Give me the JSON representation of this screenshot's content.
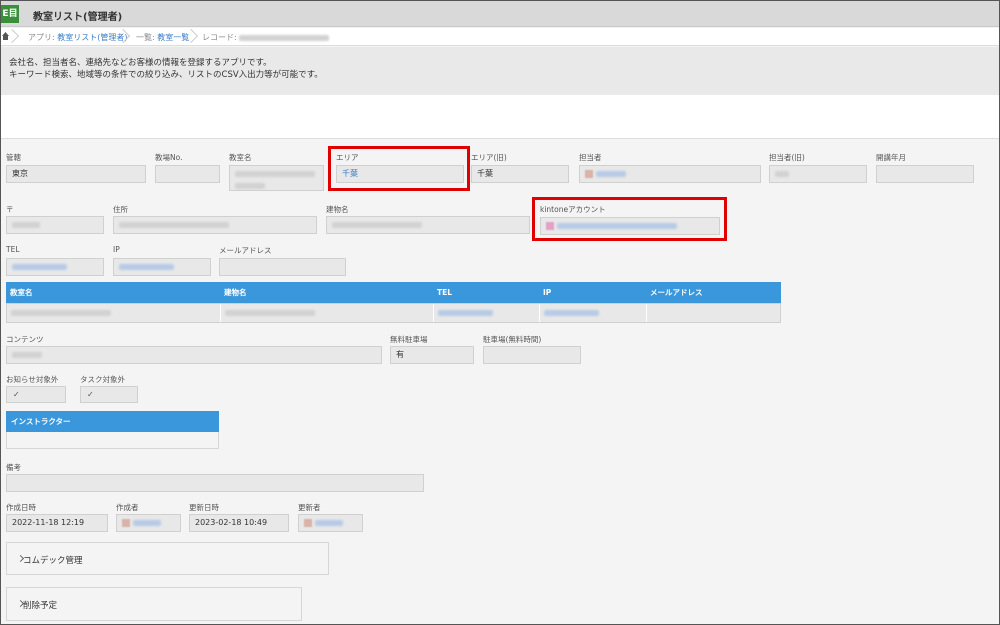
{
  "app": {
    "icon_text": "E目",
    "title": "教室リスト(管理者)"
  },
  "breadcrumb": {
    "app_prefix": "アプリ: ",
    "app_link": "教室リスト(管理者)",
    "list_prefix": "一覧: ",
    "list_link": "教室一覧",
    "record_prefix": "レコード: "
  },
  "description": {
    "line1": "会社名、担当者名、連絡先などお客様の情報を登録するアプリです。",
    "line2": "キーワード検索、地域等の条件での絞り込み、リストのCSV入出力等が可能です。"
  },
  "fields": {
    "kankatsu": {
      "label": "管轄",
      "value": "東京"
    },
    "kyoshitsu_no": {
      "label": "教場No.",
      "value": ""
    },
    "kyoshitsu_name": {
      "label": "教室名"
    },
    "area": {
      "label": "エリア",
      "value": "千葉"
    },
    "area_old": {
      "label": "エリア(旧)",
      "value": "千葉"
    },
    "tantousha": {
      "label": "担当者"
    },
    "tantousha_old": {
      "label": "担当者(旧)"
    },
    "kaikou": {
      "label": "開講年月",
      "value": ""
    },
    "postal": {
      "label": "〒"
    },
    "address": {
      "label": "住所"
    },
    "building": {
      "label": "建物名"
    },
    "kintone": {
      "label": "kintoneアカウント"
    },
    "tel": {
      "label": "TEL"
    },
    "ip": {
      "label": "IP"
    },
    "mail": {
      "label": "メールアドレス",
      "value": ""
    },
    "contents": {
      "label": "コンテンツ"
    },
    "parking_free": {
      "label": "無料駐車場",
      "value": "有"
    },
    "parking_free_time": {
      "label": "駐車場(無料時間)",
      "value": ""
    },
    "notice_excluded": {
      "label": "お知らせ対象外",
      "value": "✓"
    },
    "task_excluded": {
      "label": "タスク対象外",
      "value": "✓"
    },
    "remarks": {
      "label": "備考",
      "value": ""
    },
    "created_at": {
      "label": "作成日時",
      "value": "2022-11-18 12:19"
    },
    "creator": {
      "label": "作成者"
    },
    "updated_at": {
      "label": "更新日時",
      "value": "2023-02-18 10:49"
    },
    "updater": {
      "label": "更新者"
    }
  },
  "table": {
    "headers": [
      "教室名",
      "建物名",
      "TEL",
      "IP",
      "メールアドレス"
    ]
  },
  "instructor": {
    "header": "インストラクター"
  },
  "groups": {
    "comdec": "コムデック管理",
    "delete": "削除予定"
  },
  "colors": {
    "accent_blue": "#3b97dc",
    "highlight_red": "#e00000",
    "link_blue": "#3b7ec9"
  }
}
